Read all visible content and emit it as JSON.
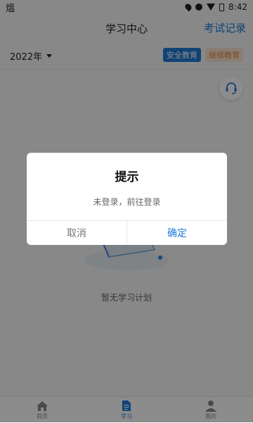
{
  "status_bar": {
    "left_glyph": "熅",
    "time": "8:42"
  },
  "header": {
    "title": "学习中心",
    "action": "考试记录"
  },
  "filter": {
    "year": "2022年",
    "tags": [
      "安全教育",
      "继续教育"
    ]
  },
  "empty": {
    "message": "暂无学习计划"
  },
  "tabbar": {
    "items": [
      "首页",
      "学习",
      "我的"
    ]
  },
  "dialog": {
    "title": "提示",
    "message": "未登录，前往登录",
    "cancel": "取消",
    "confirm": "确定"
  },
  "colors": {
    "accent": "#1e7bd6",
    "tag_continue_bg": "#fbe3cf"
  }
}
